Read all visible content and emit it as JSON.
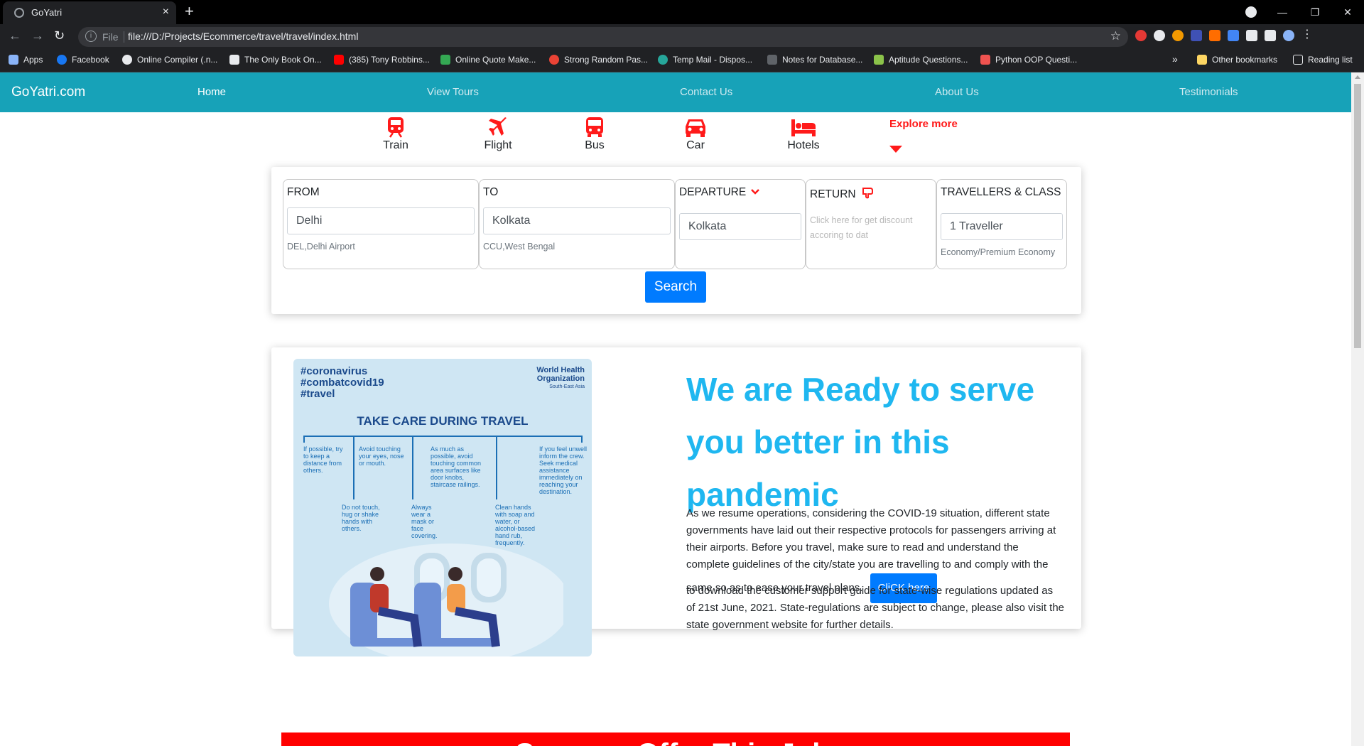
{
  "browser": {
    "tab_title": "GoYatri",
    "tab_close": "×",
    "new_tab": "+",
    "omnibox_scheme": "File",
    "url": "file:///D:/Projects/Ecommerce/travel/travel/index.html",
    "bookmarks": [
      {
        "label": "Apps",
        "icon": "apps-grid-icon",
        "color": "#8ab4f8"
      },
      {
        "label": "Facebook",
        "icon": "facebook-icon",
        "color": "#1877f2"
      },
      {
        "label": "Online Compiler (.n...",
        "icon": "compiler-icon",
        "color": "#e8eaed"
      },
      {
        "label": "The Only Book On...",
        "icon": "book-icon",
        "color": "#e8eaed"
      },
      {
        "label": "(385) Tony Robbins...",
        "icon": "youtube-icon",
        "color": "#ff0000"
      },
      {
        "label": "Online Quote Make...",
        "icon": "quote-icon",
        "color": "#34a853"
      },
      {
        "label": "Strong Random Pas...",
        "icon": "password-icon",
        "color": "#ea4335"
      },
      {
        "label": "Temp Mail - Dispos...",
        "icon": "mail-icon",
        "color": "#26a69a"
      },
      {
        "label": "Notes for Database...",
        "icon": "notes-icon",
        "color": "#5f6368"
      },
      {
        "label": "Aptitude Questions...",
        "icon": "aptitude-icon",
        "color": "#8bc34a"
      },
      {
        "label": "Python OOP Questi...",
        "icon": "python-icon",
        "color": "#ef5350"
      }
    ],
    "bookmarks_overflow": "»",
    "other_bookmarks": "Other bookmarks",
    "reading_list": "Reading list",
    "other_bookmarks_color": "#fdd663"
  },
  "site": {
    "brand": "GoYatri.com",
    "nav": [
      "Home",
      "View Tours",
      "Contact Us",
      "About Us",
      "Testimonials"
    ],
    "accent_color": "#17a2b8"
  },
  "modes": [
    {
      "label": "Train",
      "icon": "train-icon"
    },
    {
      "label": "Flight",
      "icon": "flight-icon"
    },
    {
      "label": "Bus",
      "icon": "bus-icon"
    },
    {
      "label": "Car",
      "icon": "car-icon"
    },
    {
      "label": "Hotels",
      "icon": "hotel-icon"
    }
  ],
  "explore_more": "Explore more",
  "search": {
    "from_label": "FROM",
    "from_value": "Delhi",
    "from_hint": "DEL,Delhi Airport",
    "to_label": "TO",
    "to_value": "Kolkata",
    "to_hint": "CCU,West Bengal",
    "departure_label": "DEPARTURE",
    "departure_value": "Kolkata",
    "return_label": "RETURN",
    "return_note": "Click here for get discount accoring to dat",
    "travellers_label": "TRAVELLERS & CLASS",
    "travellers_value": "1 Traveller",
    "travellers_hint": "Economy/Premium Economy",
    "button": "Search"
  },
  "poster": {
    "tag1": "#coronavirus",
    "tag2": "#combatcovid19",
    "tag3": "#travel",
    "org1": "World Health",
    "org2": "Organization",
    "region": "South-East Asia",
    "title": "TAKE CARE DURING TRAVEL",
    "tips": [
      "If possible, try to keep a distance from others.",
      "Avoid touching your eyes, nose or mouth.",
      "As much as possible, avoid touching common area surfaces like door knobs, staircase railings.",
      "If you feel unwell inform the crew. Seek medical assistance immediately on reaching your destination.",
      "Do not touch, hug or shake hands with others.",
      "Always wear a mask or face covering.",
      "Clean hands with soap and water, or alcohol-based hand rub, frequently."
    ]
  },
  "info": {
    "headline": "We are Ready to serve you better in this pandemic",
    "para1": "As we resume operations, considering the COVID-19 situation, different state governments have laid out their respective protocols for passengers arriving at their airports. Before you travel, make sure to read and understand the complete guidelines of the city/state you are travelling to and comply with the same so as to ease your travel plans.",
    "button": "CliCK here",
    "para2": "to download the customer support guide for state-wise regulations updated as of 21st June, 2021. State-regulations are subject to change, please also visit the state government website for further details.",
    "headline_color": "#1fb7f0"
  },
  "offer_banner": "Summer Offer This July"
}
